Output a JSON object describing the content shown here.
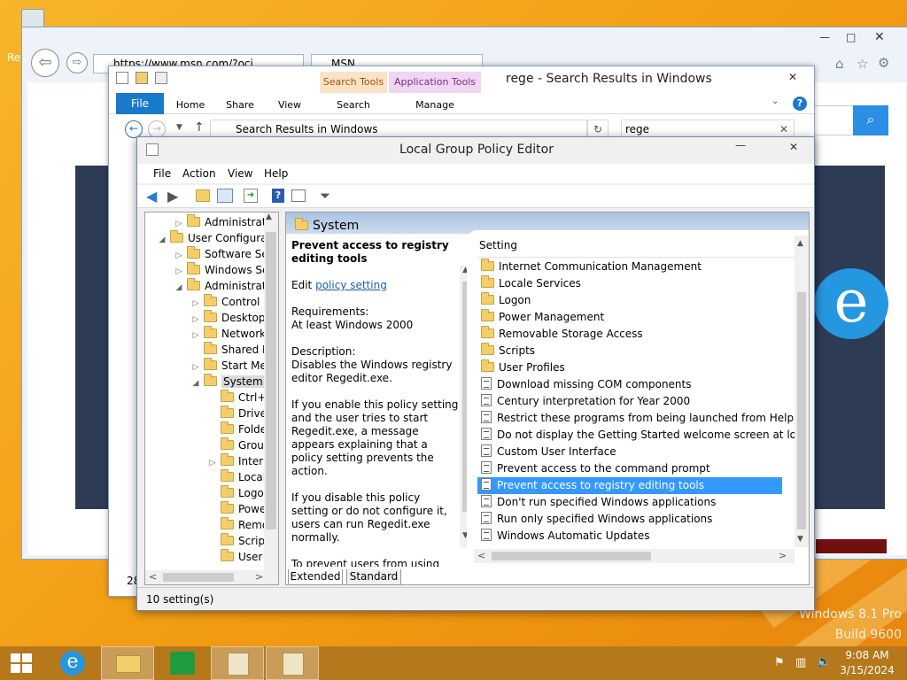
{
  "desktop": {
    "recycle_label": "Rec",
    "watermark_line1": "Windows 8.1 Pro",
    "watermark_line2": "Build 9600"
  },
  "ie": {
    "address": "https://www.msn.com/?oci",
    "tab_title": "MSN"
  },
  "explorer": {
    "title": "rege - Search Results in Windows",
    "context_search_tools": "Search Tools",
    "context_app_tools": "Application Tools",
    "tabs": [
      "File",
      "Home",
      "Share",
      "View",
      "Search",
      "Manage"
    ],
    "path": "Search Results in Windows",
    "search_value": "rege",
    "status_count": "28"
  },
  "gpedit": {
    "title": "Local Group Policy Editor",
    "menu": [
      "File",
      "Action",
      "View",
      "Help"
    ],
    "tree": [
      {
        "label": "Administrative",
        "indent": 2,
        "arrow": "▷"
      },
      {
        "label": "User Configuratio",
        "indent": 1,
        "arrow": "◢"
      },
      {
        "label": "Software Setti",
        "indent": 2,
        "arrow": "▷"
      },
      {
        "label": "Windows Sett",
        "indent": 2,
        "arrow": "▷"
      },
      {
        "label": "Administrative",
        "indent": 2,
        "arrow": "◢"
      },
      {
        "label": "Control Pa",
        "indent": 3,
        "arrow": "▷"
      },
      {
        "label": "Desktop",
        "indent": 3,
        "arrow": "▷"
      },
      {
        "label": "Network",
        "indent": 3,
        "arrow": "▷"
      },
      {
        "label": "Shared Fol",
        "indent": 3,
        "arrow": ""
      },
      {
        "label": "Start Menu",
        "indent": 3,
        "arrow": "▷"
      },
      {
        "label": "System",
        "indent": 3,
        "arrow": "◢"
      },
      {
        "label": "Ctrl+A",
        "indent": 4,
        "arrow": ""
      },
      {
        "label": "Driver",
        "indent": 4,
        "arrow": ""
      },
      {
        "label": "Folder",
        "indent": 4,
        "arrow": ""
      },
      {
        "label": "Group",
        "indent": 4,
        "arrow": ""
      },
      {
        "label": "Interne",
        "indent": 4,
        "arrow": "▷"
      },
      {
        "label": "Locale",
        "indent": 4,
        "arrow": ""
      },
      {
        "label": "Logon",
        "indent": 4,
        "arrow": ""
      },
      {
        "label": "Power",
        "indent": 4,
        "arrow": ""
      },
      {
        "label": "Remov",
        "indent": 4,
        "arrow": ""
      },
      {
        "label": "Scripts",
        "indent": 4,
        "arrow": ""
      },
      {
        "label": "User Pr",
        "indent": 4,
        "arrow": ""
      }
    ],
    "section_header": "System",
    "detail": {
      "policy_title": "Prevent access to registry editing tools",
      "edit_prefix": "Edit",
      "edit_link": "policy setting",
      "req_label": "Requirements:",
      "req_value": "At least Windows 2000",
      "desc_label": "Description:",
      "desc_value": "Disables the Windows registry editor Regedit.exe.",
      "para1": "If you enable this policy setting and the user tries to start Regedit.exe, a message appears explaining that a policy setting prevents the action.",
      "para2": "If you disable this policy setting or do not configure it, users can run Regedit.exe normally.",
      "para3": "To prevent users from using other administrative tools, use the \"Run only specified Windows"
    },
    "column_header": "Setting",
    "settings": [
      {
        "label": "Internet Communication Management",
        "type": "folder"
      },
      {
        "label": "Locale Services",
        "type": "folder"
      },
      {
        "label": "Logon",
        "type": "folder"
      },
      {
        "label": "Power Management",
        "type": "folder"
      },
      {
        "label": "Removable Storage Access",
        "type": "folder"
      },
      {
        "label": "Scripts",
        "type": "folder"
      },
      {
        "label": "User Profiles",
        "type": "folder"
      },
      {
        "label": "Download missing COM components",
        "type": "policy"
      },
      {
        "label": "Century interpretation for Year 2000",
        "type": "policy"
      },
      {
        "label": "Restrict these programs from being launched from Help",
        "type": "policy"
      },
      {
        "label": "Do not display the Getting Started welcome screen at logon",
        "type": "policy"
      },
      {
        "label": "Custom User Interface",
        "type": "policy"
      },
      {
        "label": "Prevent access to the command prompt",
        "type": "policy"
      },
      {
        "label": "Prevent access to registry editing tools",
        "type": "policy",
        "selected": true
      },
      {
        "label": "Don't run specified Windows applications",
        "type": "policy"
      },
      {
        "label": "Run only specified Windows applications",
        "type": "policy"
      },
      {
        "label": "Windows Automatic Updates",
        "type": "policy"
      }
    ],
    "view_tabs": [
      "Extended",
      "Standard"
    ],
    "status": "10 setting(s)"
  },
  "taskbar": {
    "time": "9:08 AM",
    "date": "3/15/2024"
  },
  "colors": {
    "selection": "#3399ff",
    "ribbon_file": "#1979ca",
    "taskbar": "#b5781a",
    "context_tab": "#fde3c6"
  }
}
